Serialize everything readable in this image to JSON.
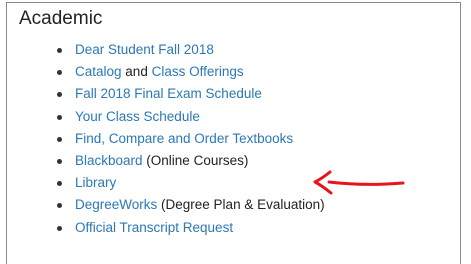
{
  "section": {
    "title": "Academic"
  },
  "items": [
    {
      "link": "Dear Student Fall 2018",
      "and": "",
      "link2": "",
      "suffix": ""
    },
    {
      "link": "Catalog",
      "and": " and ",
      "link2": "Class Offerings",
      "suffix": ""
    },
    {
      "link": "Fall 2018 Final Exam Schedule",
      "and": "",
      "link2": "",
      "suffix": ""
    },
    {
      "link": "Your Class Schedule",
      "and": "",
      "link2": "",
      "suffix": ""
    },
    {
      "link": "Find, Compare and Order Textbooks",
      "and": "",
      "link2": "",
      "suffix": ""
    },
    {
      "link": "Blackboard",
      "and": "",
      "link2": "",
      "suffix": " (Online Courses)"
    },
    {
      "link": "Library",
      "and": "",
      "link2": "",
      "suffix": ""
    },
    {
      "link": "DegreeWorks",
      "and": "",
      "link2": "",
      "suffix": " (Degree Plan & Evaluation)"
    },
    {
      "link": "Official Transcript Request",
      "and": "",
      "link2": "",
      "suffix": ""
    }
  ],
  "annotation": {
    "icon": "red-arrow-pointing-left",
    "target": "Blackboard",
    "color": "#e8141b"
  },
  "colors": {
    "link": "#2b78b5",
    "text": "#222222",
    "border": "#8a8a8a"
  }
}
